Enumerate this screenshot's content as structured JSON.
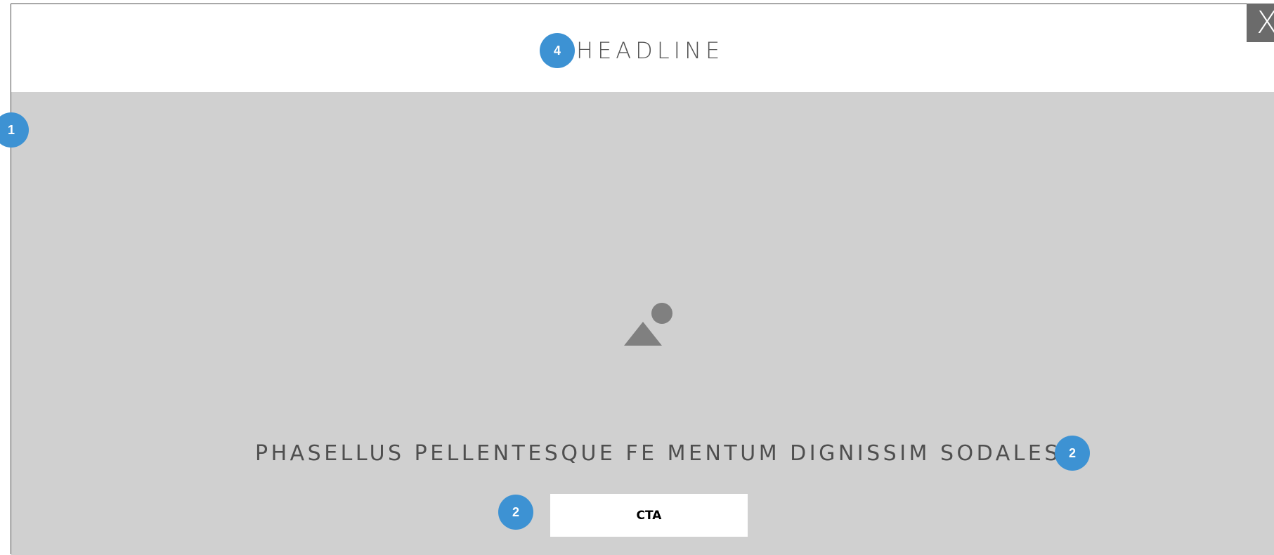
{
  "header": {
    "title": "HEADLINE",
    "badge": "4"
  },
  "hero": {
    "badge": "1",
    "image_icon": "image-placeholder-icon",
    "tagline": "PHASELLUS PELLENTESQUE FE MENTUM DIGNISSIM SODALES.",
    "tagline_badge": "2",
    "cta_label": "CTA",
    "cta_badge": "2"
  },
  "close": {
    "label": "X",
    "icon": "close-icon"
  },
  "colors": {
    "badge": "#3d92d3",
    "hero_background": "#d0d0d0",
    "close_background": "#6b6b6b",
    "icon": "#808080"
  }
}
